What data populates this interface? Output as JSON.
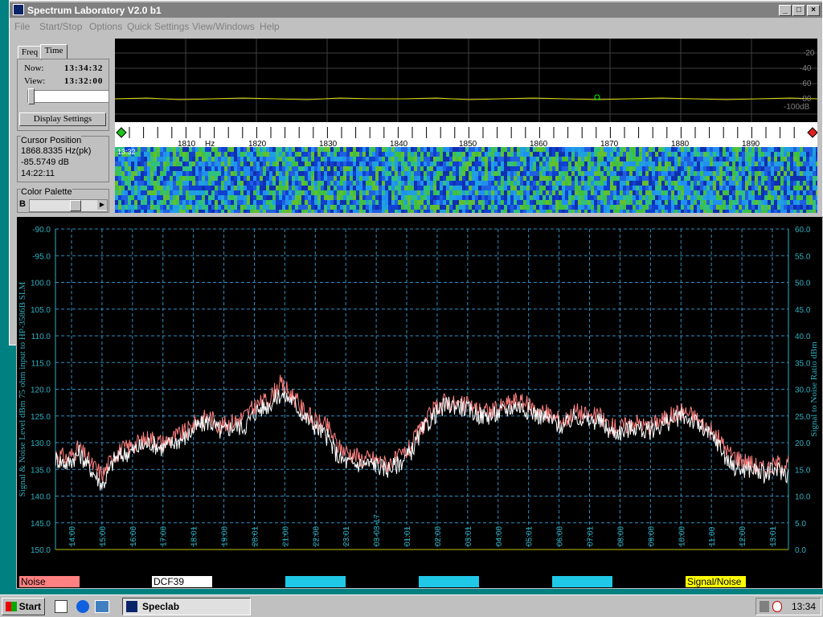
{
  "window": {
    "title": "Spectrum Laboratory V2.0 b1"
  },
  "menu": [
    "File",
    "Start/Stop",
    "Options",
    "Quick Settings",
    "View/Windows",
    "Help"
  ],
  "left_panel": {
    "tabs": [
      "Freq",
      "Time"
    ],
    "active_tab": "Time",
    "now_label": "Now:",
    "now_value": "13:34:32",
    "view_label": "View:",
    "view_value": "13:32:00",
    "display_settings": "Display Settings",
    "cursor_title": "Cursor Position",
    "cursor_freq": "1868.8335 Hz(pk)",
    "cursor_db": "-85.5749 dB",
    "cursor_time": "14:22:11",
    "palette_title": "Color Palette",
    "palette_label": "B"
  },
  "spectrum": {
    "db_labels": [
      "-20",
      "-40",
      "-60",
      "-80",
      "-100dB"
    ],
    "freq_labels": [
      "1810",
      "Hz",
      "1820",
      "1830",
      "1840",
      "1850",
      "1860",
      "1870",
      "1880",
      "1890"
    ],
    "waterfall_time": "13:32"
  },
  "chart_data": {
    "type": "line",
    "ylabel_left": "Signal & Noise Level  dBm 75 ohm input to HP-3586B SLM",
    "ylabel_right": "Signal to Noise Ratio  dBm",
    "ylim_left": [
      -150,
      -90
    ],
    "yticks_left": [
      "-90.0",
      "-95.0",
      "100.0",
      "105.0",
      "110.0",
      "115.0",
      "120.0",
      "125.0",
      "130.0",
      "135.0",
      "140.0",
      "145.0",
      "150.0"
    ],
    "ylim_right": [
      0,
      60
    ],
    "yticks_right": [
      "60.0",
      "55.0",
      "50.0",
      "45.0",
      "40.0",
      "35.0",
      "30.0",
      "25.0",
      "20.0",
      "15.0",
      "10.0",
      "5.0",
      "0.0"
    ],
    "xticks": [
      "14:00",
      "15:00",
      "16:00",
      "17:00",
      "18:01",
      "19:00",
      "20:01",
      "21:00",
      "22:00",
      "23:01",
      "03-03-17",
      "01:01",
      "02:00",
      "03:01",
      "04:00",
      "05:01",
      "06:00",
      "07:01",
      "08:00",
      "09:00",
      "10:00",
      "11:00",
      "12:00",
      "13:01"
    ],
    "grid": true,
    "series": [
      {
        "name": "Noise",
        "color": "#ff8080",
        "values": [
          -132,
          -133,
          -131,
          -134,
          -136,
          -132,
          -131,
          -130,
          -129,
          -130,
          -129,
          -128,
          -126,
          -125,
          -127,
          -126,
          -125,
          -123,
          -122,
          -119,
          -121,
          -124,
          -126,
          -127,
          -131,
          -132,
          -133,
          -133,
          -134,
          -133,
          -131,
          -127,
          -124,
          -122,
          -123,
          -123,
          -124,
          -124,
          -123,
          -122,
          -123,
          -124,
          -125,
          -126,
          -124,
          -125,
          -125,
          -127,
          -127,
          -126,
          -127,
          -126,
          -125,
          -124,
          -125,
          -127,
          -129,
          -132,
          -133,
          -134,
          -135,
          -134,
          -134
        ]
      },
      {
        "name": "DCF39",
        "color": "#ffffff",
        "values": [
          -133,
          -134,
          -132,
          -135,
          -138,
          -133,
          -132,
          -131,
          -130,
          -131,
          -130,
          -129,
          -127,
          -126,
          -128,
          -127,
          -127,
          -124,
          -123,
          -121,
          -122,
          -125,
          -127,
          -129,
          -133,
          -134,
          -134,
          -134,
          -135,
          -134,
          -132,
          -128,
          -125,
          -123,
          -123,
          -124,
          -125,
          -125,
          -124,
          -123,
          -124,
          -125,
          -126,
          -127,
          -125,
          -126,
          -126,
          -128,
          -128,
          -127,
          -128,
          -127,
          -126,
          -125,
          -126,
          -128,
          -130,
          -134,
          -135,
          -135,
          -136,
          -135,
          -136
        ]
      },
      {
        "name": "Signal/Noise",
        "color": "#ffff00",
        "values": []
      }
    ]
  },
  "legend": [
    {
      "label": "Noise",
      "bg": "#ff8080",
      "fg": "#000000"
    },
    {
      "label": "DCF39",
      "bg": "#ffffff",
      "fg": "#000000"
    },
    {
      "label": "",
      "bg": "#20c8e8",
      "fg": "#000000"
    },
    {
      "label": "",
      "bg": "#20c8e8",
      "fg": "#000000"
    },
    {
      "label": "",
      "bg": "#20c8e8",
      "fg": "#000000"
    },
    {
      "label": "Signal/Noise",
      "bg": "#ffff00",
      "fg": "#000000"
    }
  ],
  "taskbar": {
    "start": "Start",
    "task": "Speclab",
    "clock": "13:34"
  }
}
